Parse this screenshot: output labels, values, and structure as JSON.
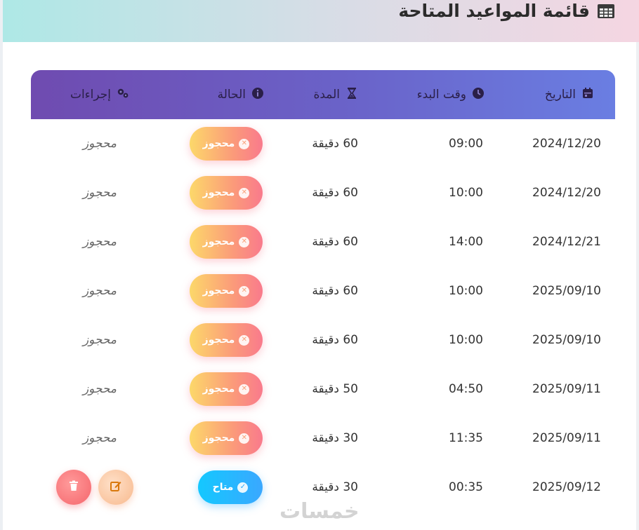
{
  "header": {
    "title": "قائمة المواعيد المتاحة",
    "icon": "table-icon"
  },
  "table": {
    "columns": [
      {
        "label": "التاريخ",
        "icon": "calendar-icon"
      },
      {
        "label": "وقت البدء",
        "icon": "clock-icon"
      },
      {
        "label": "المدة",
        "icon": "hourglass-icon"
      },
      {
        "label": "الحالة",
        "icon": "info-icon"
      },
      {
        "label": "إجراءات",
        "icon": "gears-icon"
      }
    ],
    "rows": [
      {
        "date": "2024/12/20",
        "time": "09:00",
        "duration": "60 دقيقة",
        "status": "محجوز",
        "action": "محجوز"
      },
      {
        "date": "2024/12/20",
        "time": "10:00",
        "duration": "60 دقيقة",
        "status": "محجوز",
        "action": "محجوز"
      },
      {
        "date": "2024/12/21",
        "time": "14:00",
        "duration": "60 دقيقة",
        "status": "محجوز",
        "action": "محجوز"
      },
      {
        "date": "2025/09/10",
        "time": "10:00",
        "duration": "60 دقيقة",
        "status": "محجوز",
        "action": "محجوز"
      },
      {
        "date": "2025/09/10",
        "time": "10:00",
        "duration": "60 دقيقة",
        "status": "محجوز",
        "action": "محجوز"
      },
      {
        "date": "2025/09/11",
        "time": "04:50",
        "duration": "50 دقيقة",
        "status": "محجوز",
        "action": "محجوز"
      },
      {
        "date": "2025/09/11",
        "time": "11:35",
        "duration": "30 دقيقة",
        "status": "محجوز",
        "action": "محجوز"
      },
      {
        "date": "2025/09/12",
        "time": "00:35",
        "duration": "30 دقيقة",
        "status": "متاح"
      }
    ]
  },
  "watermark": "خمسات",
  "colors": {
    "header_start": "#6f4bb0",
    "header_end": "#6a7ee2",
    "booked_start": "#fcd86a",
    "booked_end": "#f97a8c",
    "available_start": "#14c8ff",
    "available_end": "#3aa8ff",
    "edit": "#f7b98d",
    "delete": "#f5666c"
  }
}
